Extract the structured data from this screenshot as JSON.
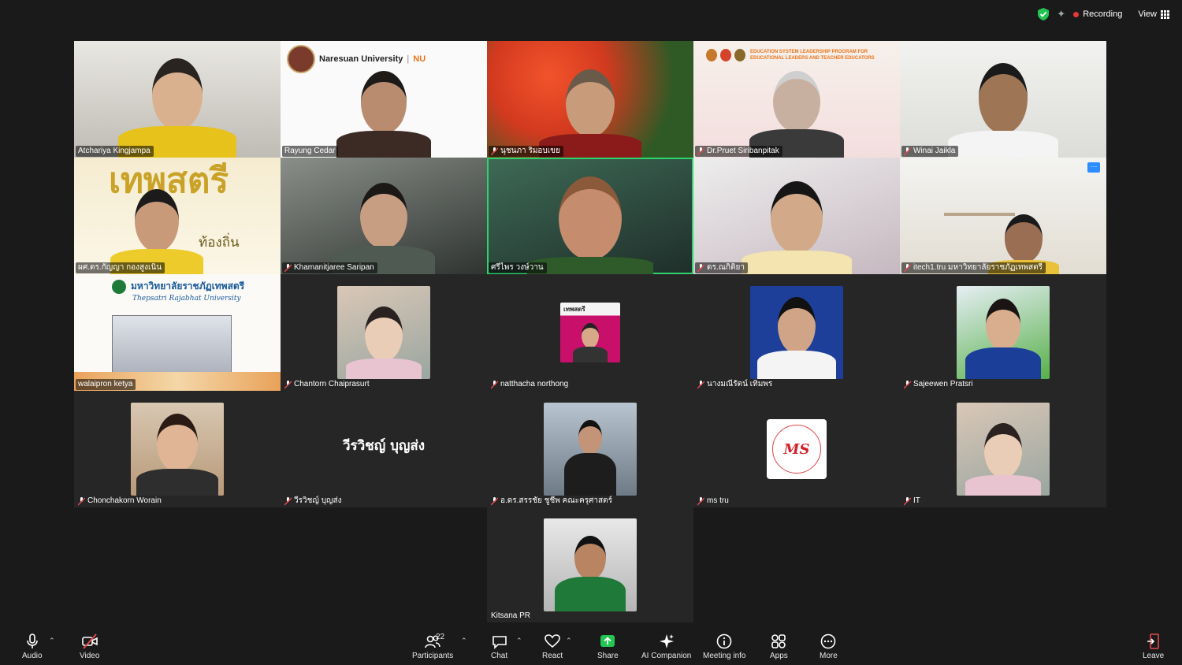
{
  "topbar": {
    "recording_label": "Recording",
    "view_label": "View"
  },
  "toolbar": {
    "audio": "Audio",
    "video": "Video",
    "participants": "Participants",
    "participant_count": "22",
    "chat": "Chat",
    "react": "React",
    "share": "Share",
    "ai": "AI Companion",
    "meeting_info": "Meeting info",
    "apps": "Apps",
    "more": "More",
    "leave": "Leave"
  },
  "banners": {
    "nu": "Naresuan University",
    "nu_short": "NU",
    "edu": "EDUCATION SYSTEM LEADERSHIP PROGRAM FOR EDUCATIONAL LEADERS AND TEACHER EDUCATORS",
    "tru": "มหาวิทยาลัยราชภัฏเทพสตรี",
    "tru_en": "Thepsatri Rajabhat University",
    "festival": "เทพสตรี",
    "festival_sub": "ท้องถิ่น",
    "thumb_tepsat": "เทพสตรี",
    "ms_logo": "MS"
  },
  "big_name": "วีรวิชญ์ บุญส่ง",
  "participants": [
    {
      "name": "Atchariya Kingjampa",
      "muted": false
    },
    {
      "name": "Rayung Cedar",
      "muted": false
    },
    {
      "name": "นุชนภา ริมอบเขย",
      "muted": true
    },
    {
      "name": "Dr.Pruet Siribanpitak",
      "muted": true
    },
    {
      "name": "Winai Jaikla",
      "muted": true
    },
    {
      "name": "ผศ.ดร.กัญญา กองสูงเนิน",
      "muted": false
    },
    {
      "name": "Khamanitjaree Saripan",
      "muted": true
    },
    {
      "name": "ศรีไพร วงษ์วาน",
      "muted": false
    },
    {
      "name": "ดร.ณกิติยา",
      "muted": true
    },
    {
      "name": "itech1.tru มหาวิทยาลัยราชภัฏเทพสตรี",
      "muted": true
    },
    {
      "name": "walaipron ketya",
      "muted": false
    },
    {
      "name": "Chantorn Chaiprasurt",
      "muted": true
    },
    {
      "name": "natthacha northong",
      "muted": true
    },
    {
      "name": "นางมณีรัตน์ เทิมพร",
      "muted": true
    },
    {
      "name": "Sajeewen Pratsri",
      "muted": true
    },
    {
      "name": "Chonchakorn Worain",
      "muted": true
    },
    {
      "name": "วีรวิชญ์ บุญส่ง",
      "muted": true
    },
    {
      "name": "อ.ดร.สรรชัย ชูชีพ คณะครุศาสตร์",
      "muted": true
    },
    {
      "name": "ms tru",
      "muted": true
    },
    {
      "name": "IT",
      "muted": true
    },
    {
      "name": "Kitsana PR",
      "muted": false
    }
  ]
}
